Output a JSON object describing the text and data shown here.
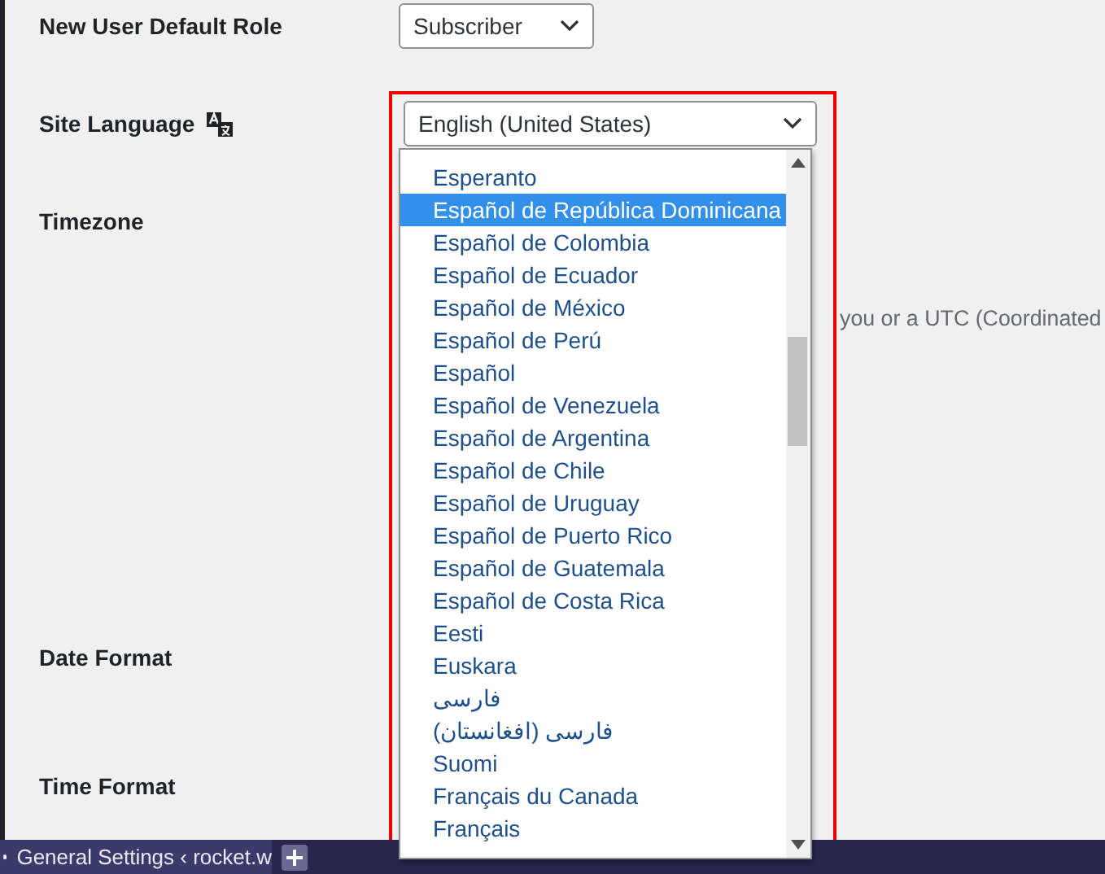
{
  "settings": [
    {
      "kind": "select",
      "label": "New User Default Role",
      "value": "Subscriber"
    },
    {
      "kind": "language",
      "label": "Site Language",
      "value": "English (United States)"
    },
    {
      "kind": "timezone",
      "label": "Timezone",
      "description": "you or a UTC (Coordinated"
    },
    {
      "kind": "plain",
      "label": "Date Format"
    },
    {
      "kind": "plain",
      "label": "Time Format"
    }
  ],
  "language_options": [
    {
      "label": "Esperanto",
      "selected": false
    },
    {
      "label": "Español de República Dominicana",
      "selected": true
    },
    {
      "label": "Español de Colombia",
      "selected": false
    },
    {
      "label": "Español de Ecuador",
      "selected": false
    },
    {
      "label": "Español de México",
      "selected": false
    },
    {
      "label": "Español de Perú",
      "selected": false
    },
    {
      "label": "Español",
      "selected": false
    },
    {
      "label": "Español de Venezuela",
      "selected": false
    },
    {
      "label": "Español de Argentina",
      "selected": false
    },
    {
      "label": "Español de Chile",
      "selected": false
    },
    {
      "label": "Español de Uruguay",
      "selected": false
    },
    {
      "label": "Español de Puerto Rico",
      "selected": false
    },
    {
      "label": "Español de Guatemala",
      "selected": false
    },
    {
      "label": "Español de Costa Rica",
      "selected": false
    },
    {
      "label": "Eesti",
      "selected": false
    },
    {
      "label": "Euskara",
      "selected": false
    },
    {
      "label": "فارسی",
      "selected": false
    },
    {
      "label": "فارسی (افغانستان)",
      "selected": false
    },
    {
      "label": "Suomi",
      "selected": false
    },
    {
      "label": "Français du Canada",
      "selected": false
    },
    {
      "label": "Français",
      "selected": false
    }
  ],
  "taskbar": {
    "tab_title": "General Settings ‹ rocket.w"
  }
}
